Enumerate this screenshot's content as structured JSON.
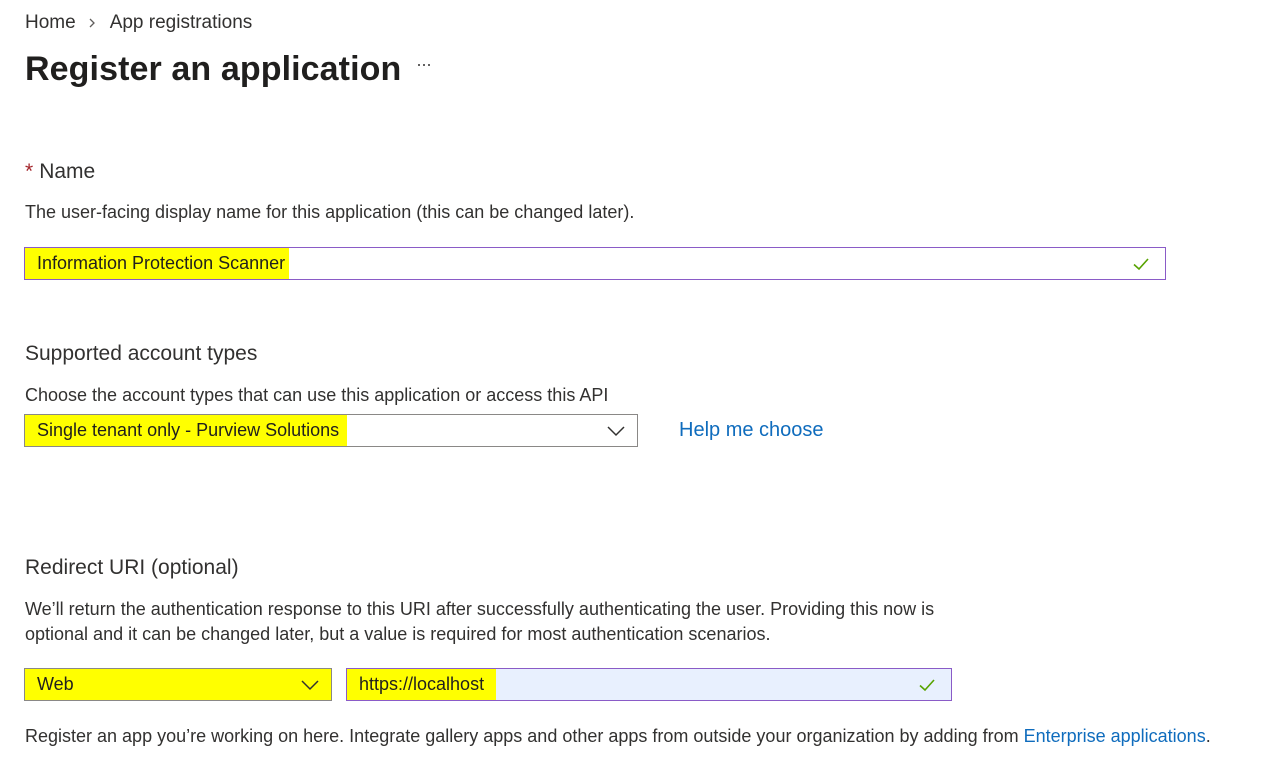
{
  "breadcrumb": {
    "home": "Home",
    "current": "App registrations"
  },
  "page": {
    "title": "Register an application",
    "more_icon": "more-ellipsis-icon"
  },
  "name_section": {
    "required_mark": "*",
    "title": "Name",
    "description": "The user-facing display name for this application (this can be changed later).",
    "input_value": "Information Protection Scanner",
    "valid_icon": "checkmark-icon"
  },
  "account_section": {
    "title": "Supported account types",
    "description": "Choose the account types that can use this application or access this API",
    "selected_value": "Single tenant only - Purview Solutions",
    "help_link": "Help me choose"
  },
  "redirect_section": {
    "title": "Redirect URI (optional)",
    "description_line1": "We’ll return the authentication response to this URI after successfully authenticating the user. Providing this now is",
    "description_line2": "optional and it can be changed later, but a value is required for most authentication scenarios.",
    "platform_value": "Web",
    "uri_value": "https://localhost"
  },
  "footer": {
    "text": "Register an app you’re working on here. Integrate gallery apps and other apps from outside your organization by adding from ",
    "link": "Enterprise applications",
    "period": "."
  },
  "colors": {
    "highlight": "#ffff00",
    "link": "#0f6cbd",
    "check": "#57a300",
    "focus_border": "#8a5bc7"
  }
}
